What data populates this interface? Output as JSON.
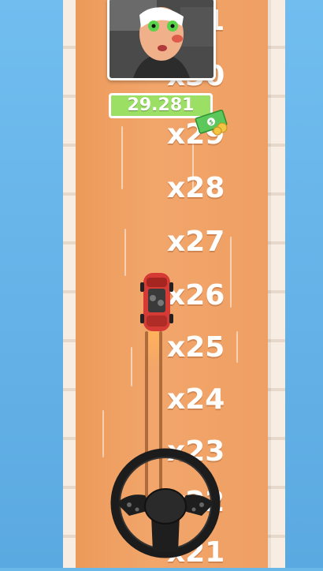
{
  "game": {
    "money_counter": "29.281",
    "multipliers": [
      "x31",
      "x30",
      "x29",
      "x28",
      "x27",
      "x26",
      "x25",
      "x24",
      "x23",
      "x22",
      "x21"
    ]
  },
  "icons": {
    "cash": "cash-icon",
    "steering_wheel": "steering-wheel-icon",
    "car": "car-icon",
    "portrait": "passenger-portrait"
  },
  "colors": {
    "track": "#f2a66b",
    "money_bar": "#9be064",
    "sky": "#6ab8e8"
  }
}
